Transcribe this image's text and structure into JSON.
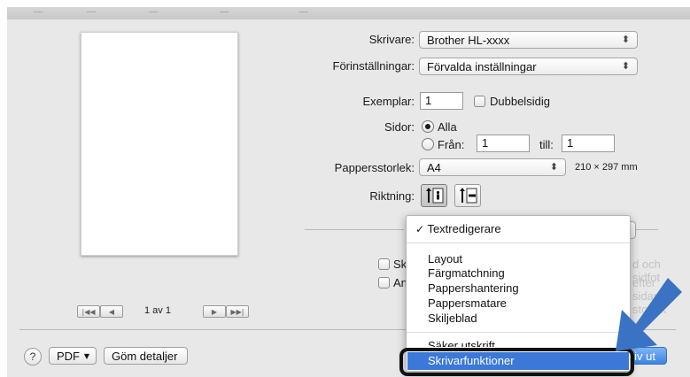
{
  "printer": {
    "label": "Skrivare:",
    "value": "Brother HL-xxxx"
  },
  "presets": {
    "label": "Förinställningar:",
    "value": "Förvalda inställningar"
  },
  "copies": {
    "label": "Exemplar:",
    "value": "1",
    "duplex_label": "Dubbelsidig"
  },
  "pages": {
    "label": "Sidor:",
    "all_label": "Alla",
    "from_label": "Från:",
    "from_value": "1",
    "to_label": "till:",
    "to_value": "1"
  },
  "paper": {
    "label": "Pappersstorlek:",
    "value": "A4",
    "dims": "210 × 297 mm"
  },
  "orientation": {
    "label": "Riktning:"
  },
  "preview": {
    "page_info": "1 av 1"
  },
  "hidden_options": {
    "opt1_visible": "Skr",
    "opt1_faded": "d och sidfot",
    "opt2_visible": "Anp",
    "opt2_faded": "efter sidans storlek"
  },
  "menu": {
    "checked_item": "Textredigerare",
    "items": [
      "Layout",
      "Färgmatchning",
      "Pappershantering",
      "Pappersmatare",
      "Skiljeblad"
    ],
    "cut_item": "Säker utskrift",
    "selected_item": "Skrivarfunktioner"
  },
  "footer": {
    "help": "?",
    "pdf": "PDF",
    "hide_details": "Göm detaljer",
    "print_partial": "riv ut"
  },
  "icons": {
    "popup_arrows": "updown-arrows-icon",
    "pdf_arrow": "chevron-down-icon",
    "annotation": "arrow-icon"
  },
  "colors": {
    "highlight": "#3c78d8",
    "annotation_arrow": "#3a72c4",
    "primary_button": "#3a84e4"
  }
}
